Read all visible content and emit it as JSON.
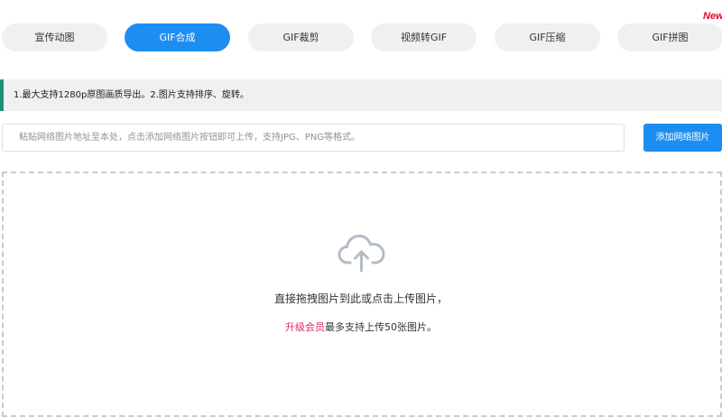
{
  "tabs": [
    {
      "label": "宣传动图",
      "active": false
    },
    {
      "label": "GIF合成",
      "active": true
    },
    {
      "label": "GIF裁剪",
      "active": false
    },
    {
      "label": "视频转GIF",
      "active": false
    },
    {
      "label": "GIF压缩",
      "active": false
    },
    {
      "label": "GIF拼图",
      "active": false
    }
  ],
  "new_badge": "New",
  "notice": "1.最大支持1280p原图画质导出。2.图片支持排序、旋转。",
  "url_input": {
    "placeholder": "粘贴网络图片地址至本处，点击添加网络图片按钮即可上传，支持JPG、PNG等格式。",
    "value": ""
  },
  "add_button_label": "添加网络图片",
  "dropzone": {
    "icon": "cloud-upload-icon",
    "main_text": "直接拖拽图片到此或点击上传图片，",
    "vip_link": "升级会员",
    "sub_text": "最多支持上传50张图片。"
  },
  "colors": {
    "accent": "#1c8ef1",
    "tab_bg": "#eef0f1",
    "notice_border": "#1f8f78",
    "vip_link": "#e4246f",
    "new_badge": "#e8002a",
    "dash_border": "#c4ccd6"
  }
}
